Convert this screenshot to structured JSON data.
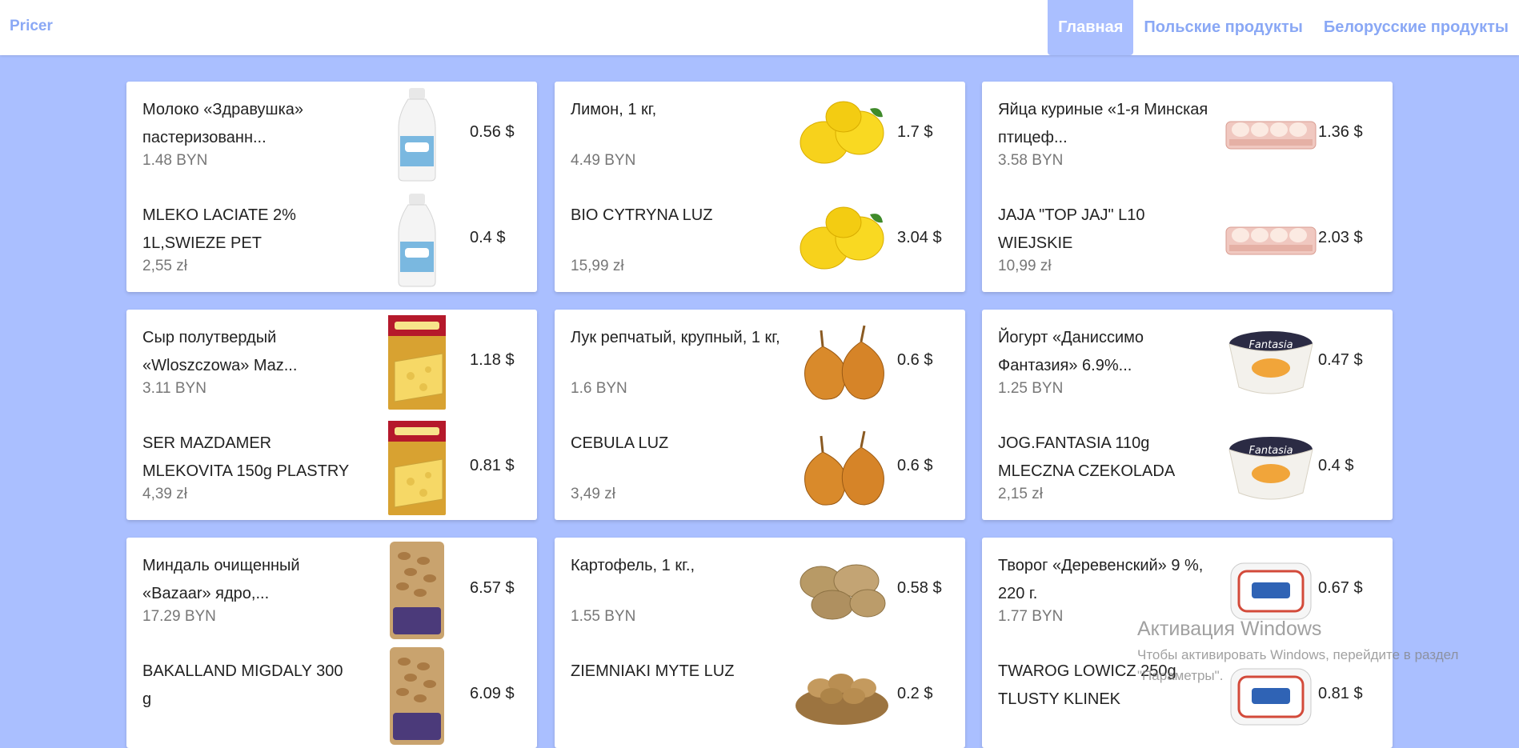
{
  "brand": "Pricer",
  "nav": [
    "Главная",
    "Польские продукты",
    "Белорусские продукты"
  ],
  "cards": [
    {
      "items": [
        {
          "name": "Молоко «Здравушка» пастеризованн...",
          "price": "1.48 BYN",
          "usd": "0.56 $",
          "icon": "milk-bottle-icon"
        },
        {
          "name": "MLEKO LACIATE 2% 1L,SWIEZE PET",
          "price": "2,55 zł",
          "usd": "0.4 $",
          "icon": "milk-bottle-icon"
        }
      ]
    },
    {
      "items": [
        {
          "name": "Лимон, 1 кг,",
          "price": "4.49 BYN",
          "usd": "1.7 $",
          "icon": "lemon-icon"
        },
        {
          "name": "BIO CYTRYNA LUZ",
          "price": "15,99 zł",
          "usd": "3.04 $",
          "icon": "lemon-icon"
        }
      ]
    },
    {
      "items": [
        {
          "name": "Яйца куриные «1-я Минская птицеф...",
          "price": "3.58 BYN",
          "usd": "1.36 $",
          "icon": "eggs-icon"
        },
        {
          "name": "JAJA \"TOP JAJ\" L10 WIEJSKIE",
          "price": "10,99 zł",
          "usd": "2.03 $",
          "icon": "eggs-icon"
        }
      ]
    },
    {
      "items": [
        {
          "name": "Сыр полутвердый «Wloszczowa» Maz...",
          "price": "3.11 BYN",
          "usd": "1.18 $",
          "icon": "cheese-package-icon"
        },
        {
          "name": "SER MAZDAMER MLEKOVITA 150g PLASTRY",
          "price": "4,39 zł",
          "usd": "0.81 $",
          "icon": "cheese-package-icon"
        }
      ]
    },
    {
      "items": [
        {
          "name": "Лук репчатый, крупный, 1 кг,",
          "price": "1.6 BYN",
          "usd": "0.6 $",
          "icon": "onion-icon"
        },
        {
          "name": "CEBULA LUZ",
          "price": "3,49 zł",
          "usd": "0.6 $",
          "icon": "onion-icon"
        }
      ]
    },
    {
      "items": [
        {
          "name": "Йогурт «Даниссимо Фантазия» 6.9%...",
          "price": "1.25 BYN",
          "usd": "0.47 $",
          "icon": "yogurt-cup-icon"
        },
        {
          "name": "JOG.FANTASIA 110g MLECZNA CZEKOLADA",
          "price": "2,15 zł",
          "usd": "0.4 $",
          "icon": "yogurt-cup-icon"
        }
      ]
    },
    {
      "items": [
        {
          "name": "Миндаль очищенный «Bazaar» ядро,...",
          "price": "17.29 BYN",
          "usd": "6.57 $",
          "icon": "nuts-package-icon"
        },
        {
          "name": "BAKALLAND MIGDALY 300 g",
          "price": "",
          "usd": "6.09 $",
          "icon": "nuts-package-icon"
        }
      ]
    },
    {
      "items": [
        {
          "name": "Картофель, 1 кг.,",
          "price": "1.55 BYN",
          "usd": "0.58 $",
          "icon": "potato-icon"
        },
        {
          "name": "ZIEMNIAKI MYTE LUZ",
          "price": "",
          "usd": "0.2 $",
          "icon": "potato-basket-icon"
        }
      ]
    },
    {
      "items": [
        {
          "name": "Творог «Деревенский» 9 %, 220 г.",
          "price": "1.77 BYN",
          "usd": "0.67 $",
          "icon": "cottage-cheese-icon"
        },
        {
          "name": "TWAROG LOWICZ 250g TLUSTY KLINEK",
          "price": "",
          "usd": "0.81 $",
          "icon": "cottage-cheese-icon"
        }
      ]
    }
  ],
  "watermark": {
    "title": "Активация Windows",
    "text": "Чтобы активировать Windows, перейдите в раздел \"Параметры\"."
  }
}
